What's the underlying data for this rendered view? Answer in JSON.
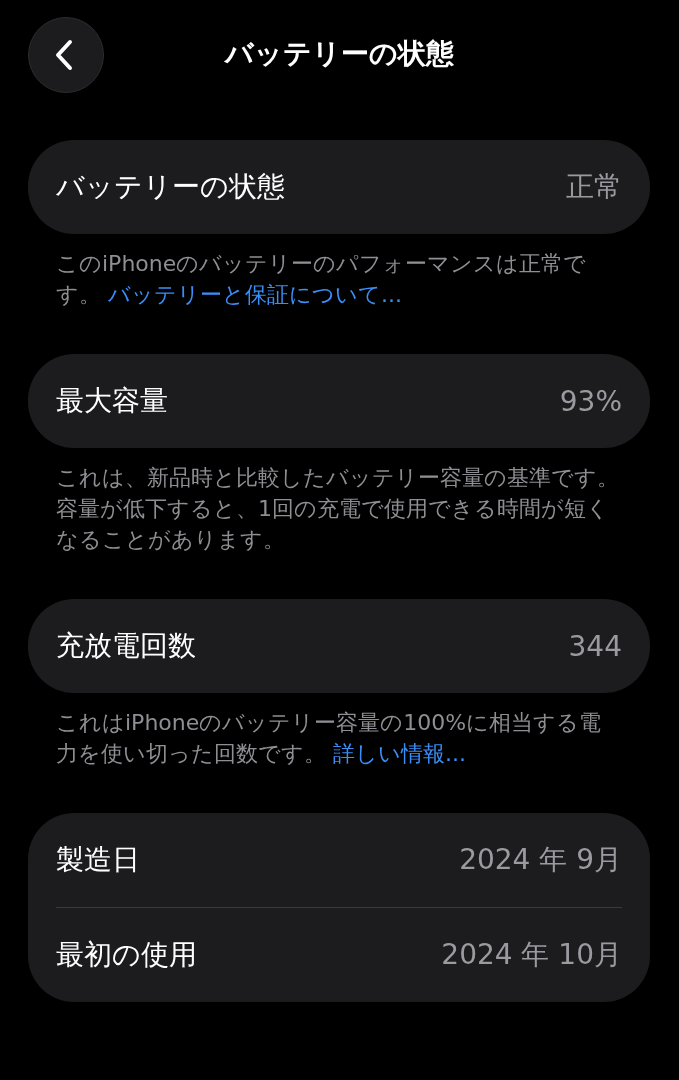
{
  "header": {
    "title": "バッテリーの状態"
  },
  "sections": [
    {
      "rows": [
        {
          "label": "バッテリーの状態",
          "value": "正常"
        }
      ],
      "footer": {
        "text": "このiPhoneのバッテリーのパフォーマンスは正常です。",
        "link": "バッテリーと保証について..."
      }
    },
    {
      "rows": [
        {
          "label": "最大容量",
          "value": "93%"
        }
      ],
      "footer": {
        "text": "これは、新品時と比較したバッテリー容量の基準です。容量が低下すると、1回の充電で使用できる時間が短くなることがあります。"
      }
    },
    {
      "rows": [
        {
          "label": "充放電回数",
          "value": "344"
        }
      ],
      "footer": {
        "text": "これはiPhoneのバッテリー容量の100%に相当する電力を使い切った回数です。",
        "link": "詳しい情報..."
      }
    },
    {
      "rows": [
        {
          "label": "製造日",
          "value": "2024 年 9月"
        },
        {
          "label": "最初の使用",
          "value": "2024 年 10月"
        }
      ]
    }
  ]
}
